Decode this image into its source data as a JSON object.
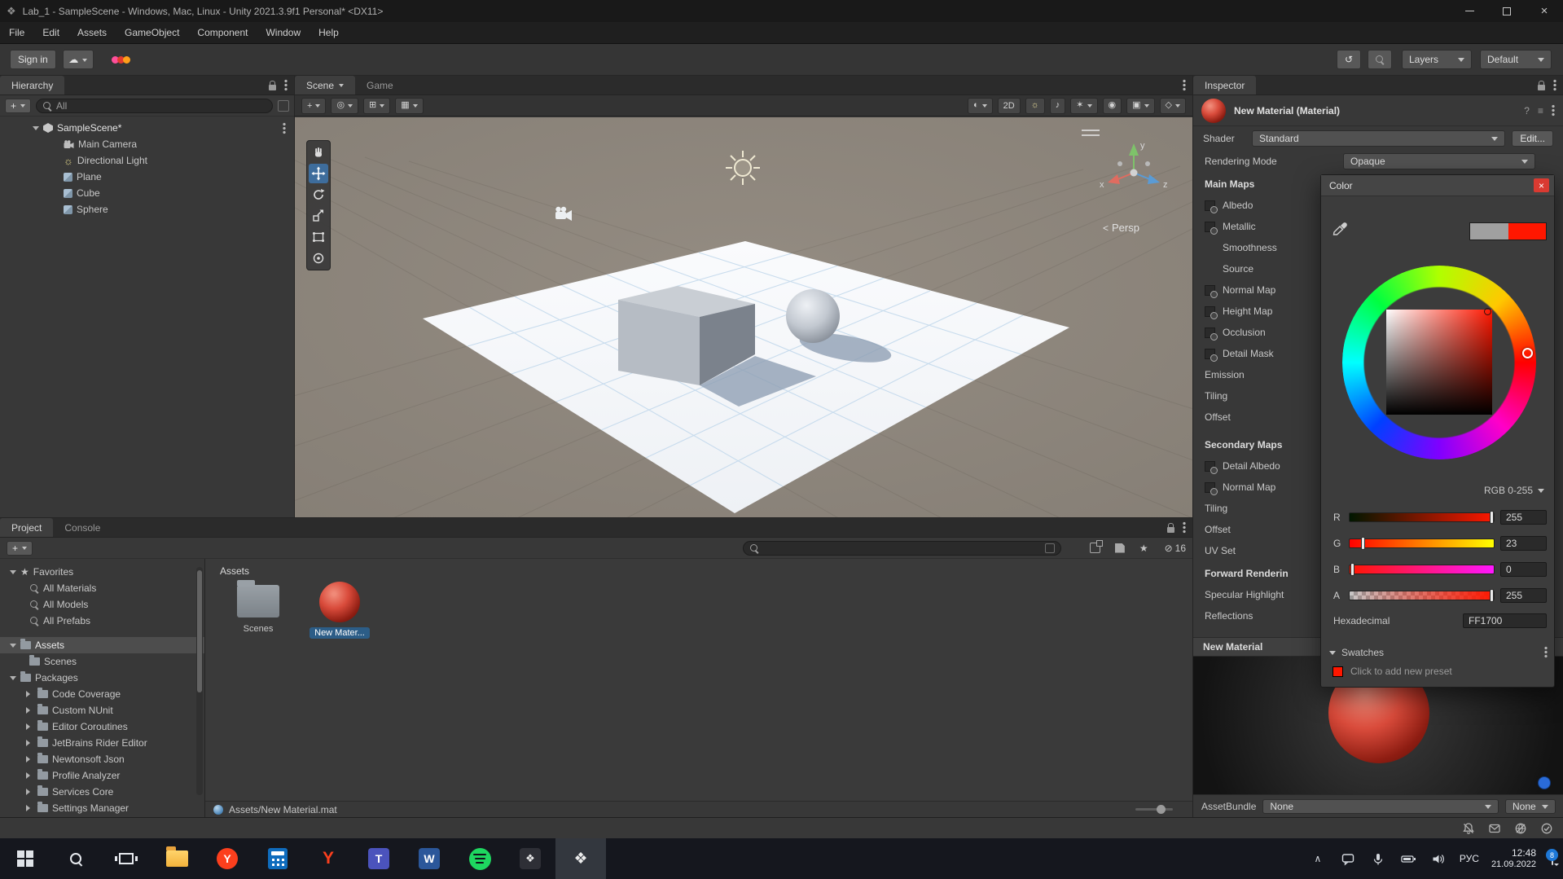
{
  "window": {
    "title": "Lab_1 - SampleScene - Windows, Mac, Linux - Unity 2021.3.9f1 Personal* <DX11>",
    "menus": [
      "File",
      "Edit",
      "Assets",
      "GameObject",
      "Component",
      "Window",
      "Help"
    ]
  },
  "icons": {
    "unity_logo": "❖",
    "cloud": "☁",
    "play": "▶",
    "history": "↺",
    "close": "×",
    "shading": "◐",
    "light": "☼",
    "audio": "♪",
    "effects": "✶",
    "visibility": "◉",
    "camera": "▣",
    "gizmo": "◇",
    "tool": "+",
    "pivot": "◎",
    "grid": "▦",
    "snap": "⊞",
    "star": "★",
    "hidden": "⊘",
    "tray_up": "∧"
  },
  "toolbar": {
    "sign_in": "Sign in",
    "layers_label": "Layers",
    "layout_label": "Default"
  },
  "hierarchy": {
    "tab_label": "Hierarchy",
    "search_text": "All",
    "scene_label": "SampleScene*",
    "items": [
      {
        "label": "Main Camera"
      },
      {
        "label": "Directional Light"
      },
      {
        "label": "Plane"
      },
      {
        "label": "Cube"
      },
      {
        "label": "Sphere"
      }
    ]
  },
  "scene_view": {
    "tab_scene": "Scene",
    "tab_game": "Game",
    "btn_2d": "2D",
    "persp_prefix": "<",
    "persp_label": "Persp",
    "axis_x": "x",
    "axis_y": "y",
    "axis_z": "z"
  },
  "project": {
    "tab_project": "Project",
    "tab_console": "Console",
    "favorites_label": "Favorites",
    "favorites": [
      {
        "label": "All Materials"
      },
      {
        "label": "All Models"
      },
      {
        "label": "All Prefabs"
      }
    ],
    "assets_label": "Assets",
    "scenes_label": "Scenes",
    "packages_label": "Packages",
    "packages": [
      {
        "label": "Code Coverage"
      },
      {
        "label": "Custom NUnit"
      },
      {
        "label": "Editor Coroutines"
      },
      {
        "label": "JetBrains Rider Editor"
      },
      {
        "label": "Newtonsoft Json"
      },
      {
        "label": "Profile Analyzer"
      },
      {
        "label": "Services Core"
      },
      {
        "label": "Settings Manager"
      }
    ],
    "grid_title": "Assets",
    "item_scenes": "Scenes",
    "item_material": "New Mater...",
    "status_path": "Assets/New Material.mat",
    "hidden_count": "16"
  },
  "inspector": {
    "tab_label": "Inspector",
    "title": "New Material (Material)",
    "shader_label": "Shader",
    "shader_value": "Standard",
    "edit_label": "Edit...",
    "rendering_mode_label": "Rendering Mode",
    "rendering_mode_value": "Opaque",
    "sections": {
      "main_maps": "Main Maps",
      "secondary_maps": "Secondary Maps",
      "forward": "Forward Renderin",
      "preview": "New Material"
    },
    "main_rows": [
      "Albedo",
      "Metallic",
      "Smoothness",
      "Source",
      "Normal Map",
      "Height Map",
      "Occlusion",
      "Detail Mask",
      "Emission",
      "Tiling",
      "Offset"
    ],
    "secondary_rows": [
      "Detail Albedo",
      "Normal Map",
      "Tiling",
      "Offset",
      "UV Set"
    ],
    "forward_rows": [
      "Specular Highlight",
      "Reflections"
    ],
    "assetbundle_label": "AssetBundle",
    "assetbundle_none1": "None",
    "assetbundle_none2": "None"
  },
  "color_picker": {
    "title": "Color",
    "mode": "RGB 0-255",
    "channels": [
      {
        "label": "R",
        "value": "255"
      },
      {
        "label": "G",
        "value": "23"
      },
      {
        "label": "B",
        "value": "0"
      },
      {
        "label": "A",
        "value": "255"
      }
    ],
    "hex_label": "Hexadecimal",
    "hex_value": "FF1700",
    "swatches_label": "Swatches",
    "swatches_hint": "Click to add new preset"
  },
  "colors": {
    "accent": "#ff1700",
    "previous_swatch": "#a0a0a0",
    "selection_blue": "#2c5d87",
    "material_red": "#d94b3b"
  },
  "taskbar": {
    "lang": "РУС",
    "time": "12:48",
    "date": "21.09.2022",
    "badge": "8",
    "letters": {
      "yandex": "Y",
      "y2": "Y",
      "teams": "T",
      "word": "W"
    }
  }
}
